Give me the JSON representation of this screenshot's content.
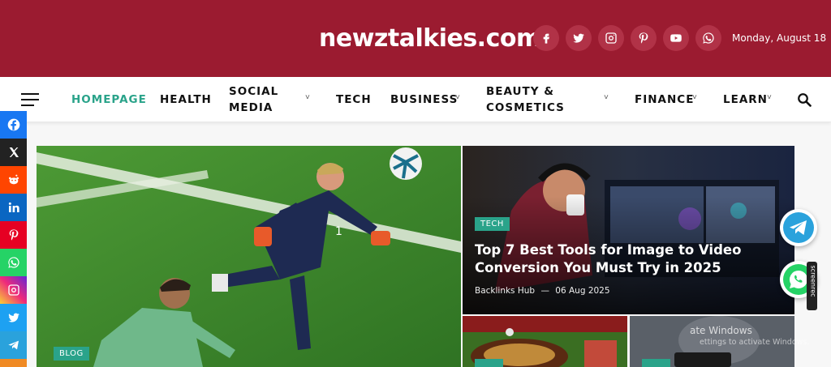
{
  "site": {
    "title": "newztalkies.com",
    "date": "Monday, August 18"
  },
  "header_social": [
    {
      "icon": "facebook-icon"
    },
    {
      "icon": "x-twitter-icon"
    },
    {
      "icon": "instagram-icon"
    },
    {
      "icon": "pinterest-icon"
    },
    {
      "icon": "youtube-icon"
    },
    {
      "icon": "whatsapp-icon"
    }
  ],
  "nav": {
    "items": [
      {
        "label": "HOMEPAGE",
        "active": true
      },
      {
        "label": "HEALTH"
      },
      {
        "label": "SOCIAL",
        "label2": "MEDIA",
        "dropdown": true
      },
      {
        "label": "TECH"
      },
      {
        "label": "BUSINESS",
        "dropdown": true
      },
      {
        "label": "BEAUTY &",
        "label2": "COSMETICS",
        "dropdown": true
      },
      {
        "label": "FINANCE",
        "dropdown": true
      },
      {
        "label": "LEARN",
        "dropdown": true
      }
    ],
    "chevron": "˅"
  },
  "share_bar": [
    {
      "icon": "facebook-icon",
      "color": "#1877f2"
    },
    {
      "icon": "x-icon",
      "color": "#222222"
    },
    {
      "icon": "reddit-icon",
      "color": "#ff4500"
    },
    {
      "icon": "linkedin-icon",
      "color": "#0a66c2"
    },
    {
      "icon": "pinterest-icon",
      "color": "#e60023"
    },
    {
      "icon": "whatsapp-icon",
      "color": "#25d366"
    },
    {
      "icon": "instagram-icon",
      "color": "#e1306c"
    },
    {
      "icon": "twitter-icon",
      "color": "#1da1f2"
    },
    {
      "icon": "telegram-icon",
      "color": "#2aa2dc"
    }
  ],
  "featured": {
    "main": {
      "badge": "BLOG"
    },
    "side": {
      "badge": "TECH",
      "title": "Top 7 Best Tools for Image to Video Conversion You Must Try in 2025",
      "author": "Backlinks Hub",
      "sep": "—",
      "date": "06 Aug 2025"
    }
  },
  "overlay": {
    "activate_title": "ate Windows",
    "activate_sub": "ettings to activate Windows.",
    "screenrec": "screenrec"
  },
  "colors": {
    "brand": "#9b1b30",
    "accent": "#2aa38a"
  }
}
